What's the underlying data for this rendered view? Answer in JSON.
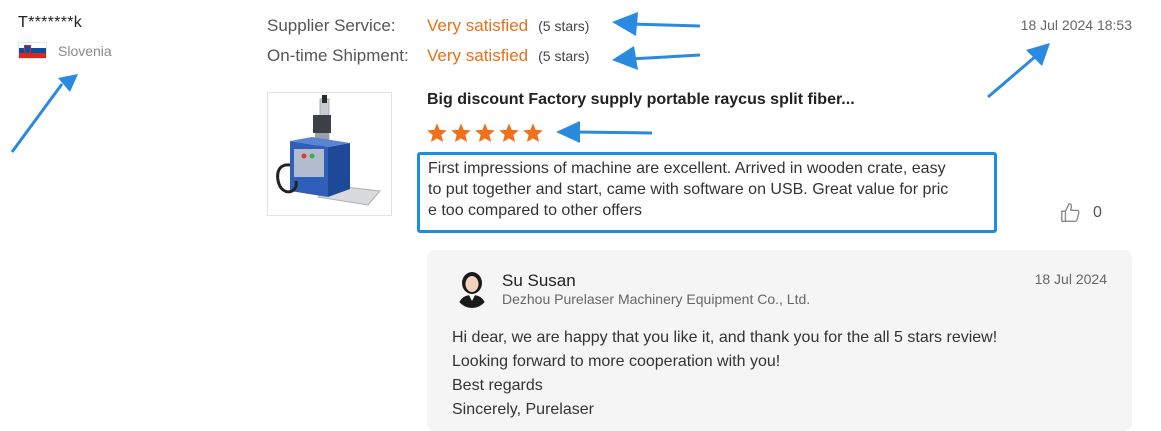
{
  "reviewer": {
    "name": "T*******k",
    "country": "Slovenia",
    "flag_icon": "slovenia-flag-icon"
  },
  "ratings": [
    {
      "label": "Supplier Service:",
      "value": "Very satisfied",
      "stars": "(5 stars)"
    },
    {
      "label": "On-time Shipment:",
      "value": "Very satisfied",
      "stars": "(5 stars)"
    }
  ],
  "review": {
    "date": "18 Jul 2024 18:53",
    "product_title": "Big discount Factory supply portable raycus split fiber...",
    "star_rating": 5,
    "lines": [
      "First impressions of machine are excellent. Arrived in wooden crate, easy",
      "to put together and start, came with software on USB. Great value for pric",
      "e too compared to other offers"
    ],
    "like_count": "0"
  },
  "reply": {
    "name": "Su Susan",
    "company": "Dezhou Purelaser Machinery Equipment Co., Ltd.",
    "date": "18 Jul 2024",
    "lines": [
      "Hi dear, we are happy that you like it, and thank you for the all 5 stars review!",
      "Looking forward to more cooperation with you!",
      "Best regards",
      "Sincerely, Purelaser"
    ]
  },
  "colors": {
    "accent_orange": "#e8701a",
    "highlight_blue": "#1e8fe0",
    "reply_bg": "#f5f5f5"
  }
}
